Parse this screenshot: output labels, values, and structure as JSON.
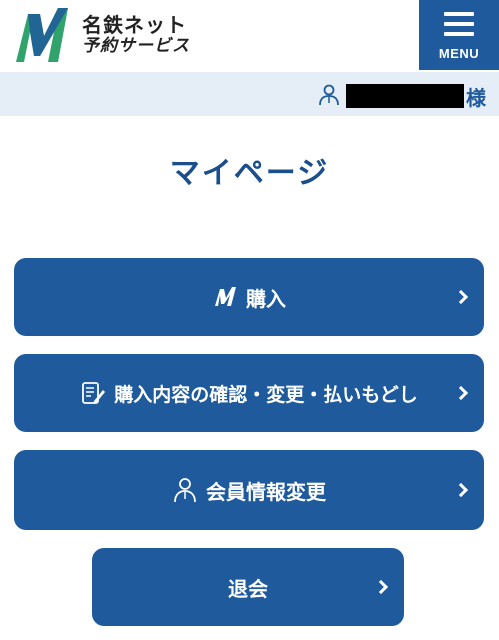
{
  "header": {
    "brand_line1": "名鉄ネット",
    "brand_line2": "予約サービス",
    "menu_label": "MENU"
  },
  "user": {
    "suffix": "様"
  },
  "page": {
    "title": "マイページ"
  },
  "actions": [
    {
      "label": "購入",
      "icon": "meitetsu-logo-icon"
    },
    {
      "label": "購入内容の確認・変更・払いもどし",
      "icon": "document-pen-icon"
    },
    {
      "label": "会員情報変更",
      "icon": "user-icon"
    },
    {
      "label": "退会",
      "icon": ""
    }
  ],
  "colors": {
    "primary": "#1e5a9c",
    "title": "#1b4f8c",
    "userbar_bg": "#e5edf6",
    "logo_green": "#2fa36b"
  }
}
